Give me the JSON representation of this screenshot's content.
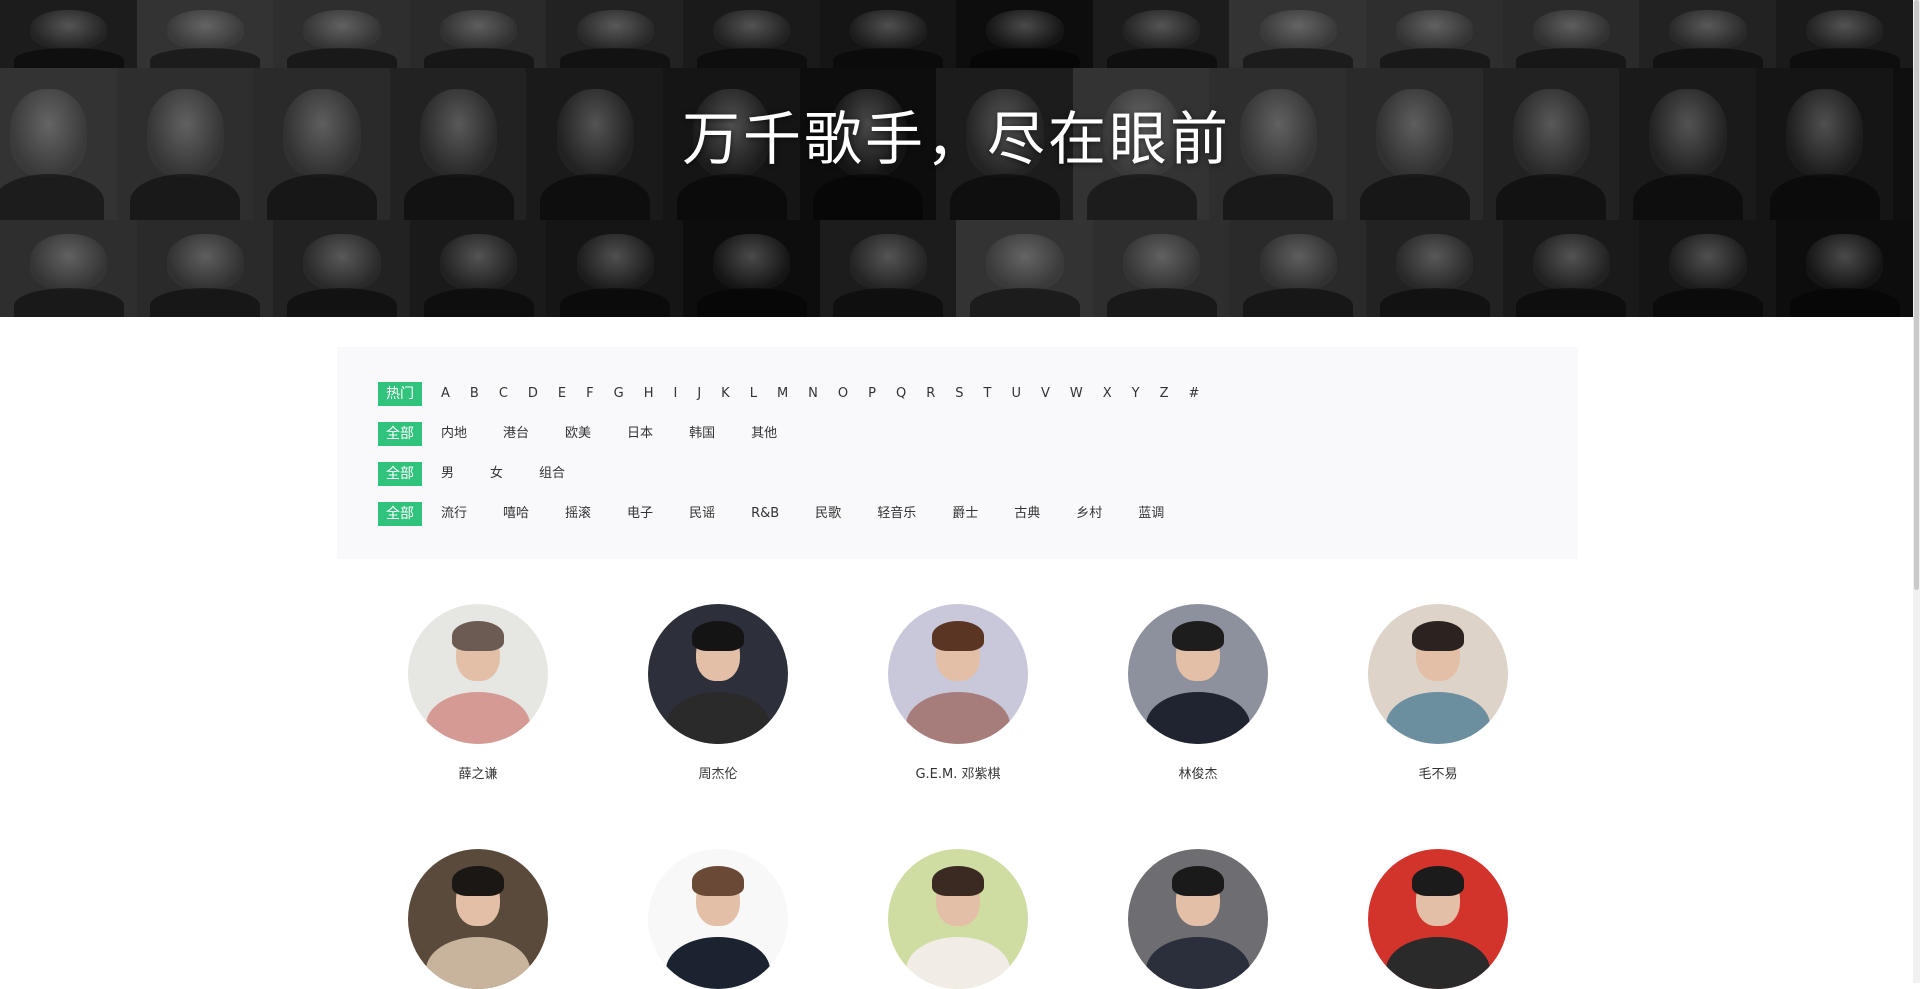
{
  "hero": {
    "title": "万千歌手，尽在眼前"
  },
  "filters": {
    "index": {
      "active": "热门",
      "options": [
        "A",
        "B",
        "C",
        "D",
        "E",
        "F",
        "G",
        "H",
        "I",
        "J",
        "K",
        "L",
        "M",
        "N",
        "O",
        "P",
        "Q",
        "R",
        "S",
        "T",
        "U",
        "V",
        "W",
        "X",
        "Y",
        "Z",
        "#"
      ]
    },
    "area": {
      "active": "全部",
      "options": [
        "内地",
        "港台",
        "欧美",
        "日本",
        "韩国",
        "其他"
      ]
    },
    "sex": {
      "active": "全部",
      "options": [
        "男",
        "女",
        "组合"
      ]
    },
    "genre": {
      "active": "全部",
      "options": [
        "流行",
        "嘻哈",
        "摇滚",
        "电子",
        "民谣",
        "R&B",
        "民歌",
        "轻音乐",
        "爵士",
        "古典",
        "乡村",
        "蓝调"
      ]
    }
  },
  "singers": [
    {
      "name": "薛之谦",
      "bg": "#e6e6e2",
      "hair": "#6b5b52",
      "outfit": "#d69a94"
    },
    {
      "name": "周杰伦",
      "bg": "#2d2f3a",
      "hair": "#141414",
      "outfit": "#2a2a2a"
    },
    {
      "name": "G.E.M. 邓紫棋",
      "bg": "#c9c8db",
      "hair": "#5a3524",
      "outfit": "#a77d7b"
    },
    {
      "name": "林俊杰",
      "bg": "#8d919d",
      "hair": "#1d1d1d",
      "outfit": "#1f2430"
    },
    {
      "name": "毛不易",
      "bg": "#ddd3c8",
      "hair": "#2b2320",
      "outfit": "#6c8fa0"
    },
    {
      "name": "",
      "bg": "#5a4a3b",
      "hair": "#1b1714",
      "outfit": "#c8b49c"
    },
    {
      "name": "",
      "bg": "#f8f8f8",
      "hair": "#6a4a36",
      "outfit": "#1b2230"
    },
    {
      "name": "",
      "bg": "#cfdca2",
      "hair": "#3a2a22",
      "outfit": "#f1ede6"
    },
    {
      "name": "",
      "bg": "#6e6e72",
      "hair": "#1a1a1a",
      "outfit": "#2b2f3c"
    },
    {
      "name": "",
      "bg": "#d2342c",
      "hair": "#1b1b1b",
      "outfit": "#2a2a2a"
    }
  ]
}
